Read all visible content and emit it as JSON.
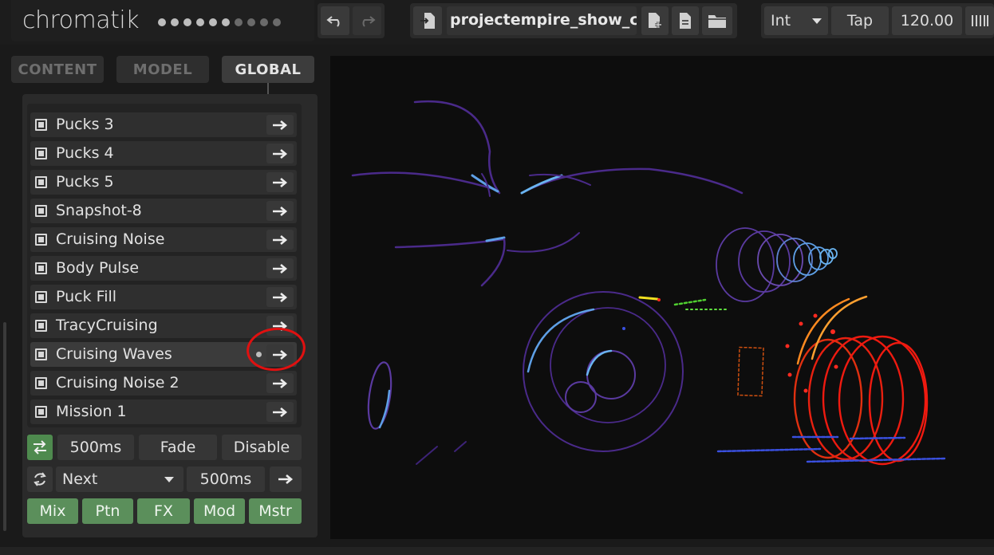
{
  "app": {
    "name": "chromatik",
    "page_dots": [
      true,
      true,
      true,
      true,
      true,
      true,
      false,
      false,
      false,
      false
    ]
  },
  "toolbar": {
    "undo_icon": "undo-icon",
    "redo_icon": "redo-icon",
    "project_name": "projectempire_show_c",
    "mode_value": "Int",
    "tap_label": "Tap",
    "bpm_value": "120.00"
  },
  "tabs": [
    {
      "label": "CONTENT",
      "active": false
    },
    {
      "label": "MODEL",
      "active": false
    },
    {
      "label": "GLOBAL",
      "active": true
    }
  ],
  "patterns": [
    {
      "label": "Pucks 3",
      "active": false
    },
    {
      "label": "Pucks 4",
      "active": false
    },
    {
      "label": "Pucks 5",
      "active": false
    },
    {
      "label": "Snapshot-8",
      "active": false
    },
    {
      "label": "Cruising Noise",
      "active": false
    },
    {
      "label": "Body Pulse",
      "active": false
    },
    {
      "label": "Puck Fill",
      "active": false
    },
    {
      "label": "TracyCruising",
      "active": false
    },
    {
      "label": "Cruising Waves",
      "active": true
    },
    {
      "label": "Cruising Noise 2",
      "active": false
    },
    {
      "label": "Mission 1",
      "active": false
    }
  ],
  "transition": {
    "time": "500ms",
    "blend": "Fade",
    "mode": "Disable"
  },
  "auto_cycle": {
    "mode": "Next",
    "time": "500ms"
  },
  "sections": [
    {
      "label": "Mix"
    },
    {
      "label": "Ptn"
    },
    {
      "label": "FX"
    },
    {
      "label": "Mod"
    },
    {
      "label": "Mstr"
    }
  ],
  "colors": {
    "accent_green": "#5b8f5b",
    "annotation_red": "#e01010"
  }
}
